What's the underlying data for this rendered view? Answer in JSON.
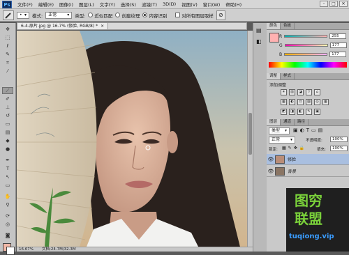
{
  "app": {
    "logo": "Ps"
  },
  "menubar": {
    "items": [
      "文件(F)",
      "编辑(E)",
      "图像(I)",
      "图层(L)",
      "文字(Y)",
      "选择(S)",
      "滤镜(T)",
      "3D(D)",
      "视图(V)",
      "窗口(W)",
      "帮助(H)"
    ],
    "window_controls": [
      "–",
      "□",
      "✕"
    ]
  },
  "options": {
    "mode_label": "模式:",
    "mode_value": "正常",
    "type_label": "类型:",
    "radio_proximity": "近似匹配",
    "radio_texture": "创建纹理",
    "radio_content": "内容识别",
    "sample_all": "对所有图层取样"
  },
  "document": {
    "tab_title": "6-4-原片.jpg @ 16.7% (修脸, RGB/8) *",
    "tab_close": "×",
    "status_zoom": "16.67%",
    "status_doc": "文档:24.7M/32.3M"
  },
  "color_panel": {
    "tabs": [
      "颜色",
      "色板"
    ],
    "r_label": "R",
    "r_value": "255",
    "g_label": "G",
    "g_value": "177",
    "b_label": "B",
    "b_value": "177",
    "swatch_color": "#ffb1b1"
  },
  "adjustments_panel": {
    "tabs": [
      "调整",
      "样式"
    ],
    "title": "添加调整",
    "row1": [
      "☀",
      "▥",
      "◪",
      "▽",
      "⌂"
    ],
    "row2": [
      "▦",
      "◐",
      "⚖",
      "▨",
      "◎",
      "▦"
    ],
    "row3": [
      "◩",
      "◨",
      "◧",
      "✎",
      "▣"
    ]
  },
  "layers_panel": {
    "tabs": [
      "图层",
      "通道",
      "路径"
    ],
    "filter_label": "类型",
    "blend_mode": "正常",
    "opacity_label": "不透明度:",
    "opacity_value": "100%",
    "lock_label": "锁定:",
    "fill_label": "填充:",
    "fill_value": "100%",
    "layers": [
      {
        "name": "修脸",
        "selected": true,
        "eye": "👁"
      },
      {
        "name": "背景",
        "selected": false,
        "eye": "👁"
      }
    ]
  },
  "watermark": {
    "line1": "图穷",
    "line2": "联盟",
    "url": "tuqiong.vip"
  }
}
